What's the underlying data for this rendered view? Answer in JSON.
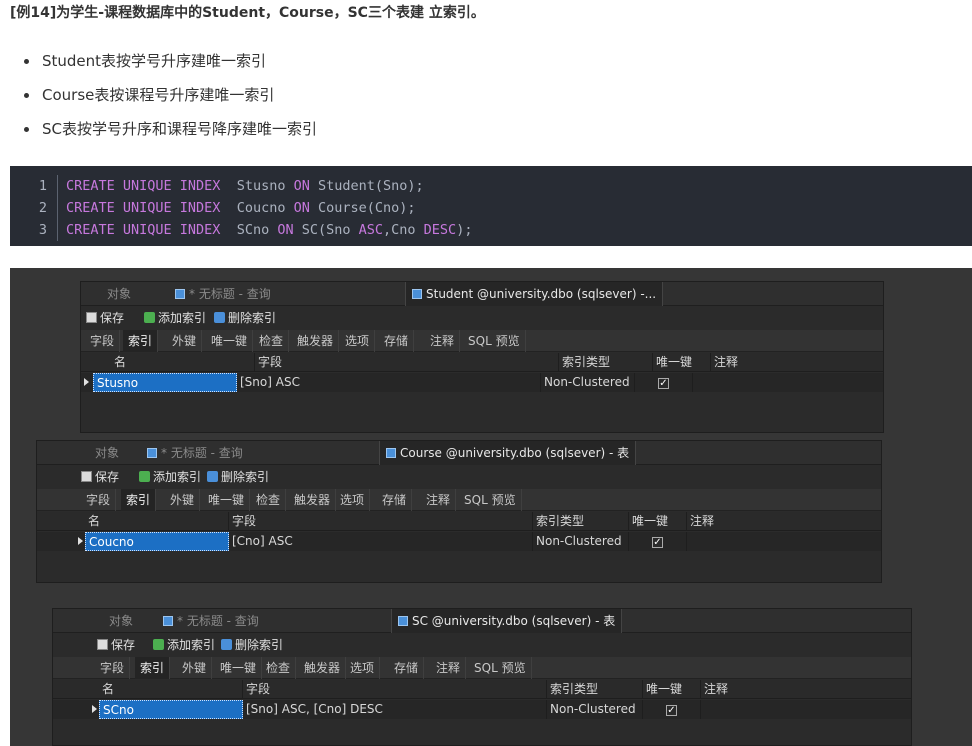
{
  "heading": "[例14]为学生-课程数据库中的Student，Course，SC三个表建 立索引。",
  "bullets": [
    "Student表按学号升序建唯一索引",
    "Course表按课程号升序建唯一索引",
    "SC表按学号升序和课程号降序建唯一索引"
  ],
  "code": {
    "lines": [
      {
        "num": "1",
        "kw1": "CREATE UNIQUE INDEX",
        "name": "  Stusno ",
        "kw2": "ON",
        "rest": " Student(Sno);"
      },
      {
        "num": "2",
        "kw1": "CREATE UNIQUE INDEX",
        "name": "  Coucno ",
        "kw2": "ON",
        "rest": " Course(Cno);"
      },
      {
        "num": "3",
        "kw1": "CREATE UNIQUE INDEX",
        "name": "  SCno ",
        "kw2": "ON",
        "rest_a": " SC(Sno ",
        "kw3": "ASC",
        "rest_b": ",Cno ",
        "kw4": "DESC",
        "rest_c": ");"
      }
    ]
  },
  "windows": [
    {
      "tabs": {
        "objects": "对象",
        "query": "* 无标题 - 查询",
        "active": "Student @university.dbo (sqlsever) -..."
      },
      "toolbar": {
        "save": "保存",
        "add": "添加索引",
        "delete": "删除索引"
      },
      "subtabs": [
        "字段",
        "索引",
        "外键",
        "唯一键",
        "检查",
        "触发器",
        "选项",
        "存储",
        "注释",
        "SQL 预览"
      ],
      "columns": {
        "name": "名",
        "field": "字段",
        "type": "索引类型",
        "unique": "唯一键",
        "comment": "注释"
      },
      "row": {
        "name": "Stusno",
        "field": "[Sno] ASC",
        "type": "Non-Clustered",
        "unique": "✓"
      }
    },
    {
      "tabs": {
        "objects": "对象",
        "query": "* 无标题 - 查询",
        "active": "Course @university.dbo (sqlsever) - 表"
      },
      "toolbar": {
        "save": "保存",
        "add": "添加索引",
        "delete": "删除索引"
      },
      "subtabs": [
        "字段",
        "索引",
        "外键",
        "唯一键",
        "检查",
        "触发器",
        "选项",
        "存储",
        "注释",
        "SQL 预览"
      ],
      "columns": {
        "name": "名",
        "field": "字段",
        "type": "索引类型",
        "unique": "唯一键",
        "comment": "注释"
      },
      "row": {
        "name": "Coucno",
        "field": "[Cno] ASC",
        "type": "Non-Clustered",
        "unique": "✓"
      }
    },
    {
      "tabs": {
        "objects": "对象",
        "query": "* 无标题 - 查询",
        "active": "SC @university.dbo (sqlsever) - 表"
      },
      "toolbar": {
        "save": "保存",
        "add": "添加索引",
        "delete": "删除索引"
      },
      "subtabs": [
        "字段",
        "索引",
        "外键",
        "唯一键",
        "检查",
        "触发器",
        "选项",
        "存储",
        "注释",
        "SQL 预览"
      ],
      "columns": {
        "name": "名",
        "field": "字段",
        "type": "索引类型",
        "unique": "唯一键",
        "comment": "注释"
      },
      "row": {
        "name": "SCno",
        "field": "[Sno] ASC, [Cno] DESC",
        "type": "Non-Clustered",
        "unique": "✓"
      }
    }
  ]
}
